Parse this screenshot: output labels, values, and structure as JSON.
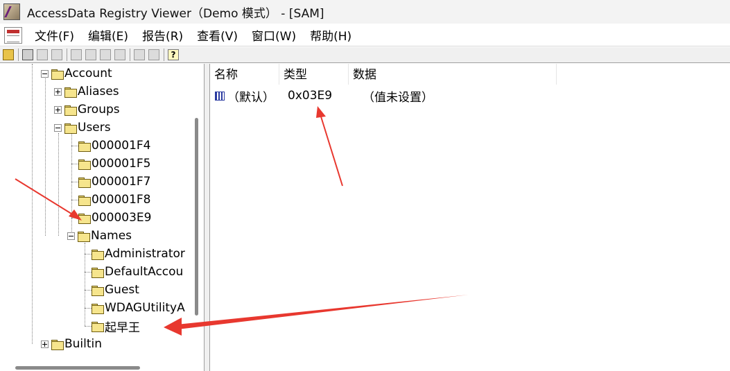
{
  "window": {
    "title": "AccessData Registry Viewer（Demo 模式） - [SAM]"
  },
  "menu": {
    "items": [
      "文件(F)",
      "编辑(E)",
      "报告(R)",
      "查看(V)",
      "窗口(W)",
      "帮助(H)"
    ]
  },
  "toolbar": {
    "buttons": [
      "open-icon",
      "print-icon",
      "find-icon",
      "key-icon",
      "export-icon",
      "report-icon",
      "edit-icon",
      "copy-icon",
      "connect-icon",
      "disconnect-icon",
      "help-icon"
    ],
    "help_glyph": "?"
  },
  "tree": {
    "nodes": [
      {
        "label": "Account",
        "level": 0,
        "expanded": true
      },
      {
        "label": "Aliases",
        "level": 1,
        "expanded": false
      },
      {
        "label": "Groups",
        "level": 1,
        "expanded": false
      },
      {
        "label": "Users",
        "level": 1,
        "expanded": true
      },
      {
        "label": "000001F4",
        "level": 2
      },
      {
        "label": "000001F5",
        "level": 2
      },
      {
        "label": "000001F7",
        "level": 2
      },
      {
        "label": "000001F8",
        "level": 2
      },
      {
        "label": "000003E9",
        "level": 2
      },
      {
        "label": "Names",
        "level": 2,
        "expanded": true
      },
      {
        "label": "Administrator",
        "level": 3
      },
      {
        "label": "DefaultAccou",
        "level": 3
      },
      {
        "label": "Guest",
        "level": 3
      },
      {
        "label": "WDAGUtilityA",
        "level": 3
      },
      {
        "label": "起早王",
        "level": 3
      },
      {
        "label": "Builtin",
        "level": 0,
        "expanded": false
      }
    ]
  },
  "list": {
    "columns": [
      "名称",
      "类型",
      "数据"
    ],
    "rows": [
      {
        "name": "（默认）",
        "type": "0x03E9",
        "data": "（值未设置）"
      }
    ]
  },
  "colors": {
    "annotation_red": "#e8382f",
    "folder_yellow": "#f6e58d"
  }
}
